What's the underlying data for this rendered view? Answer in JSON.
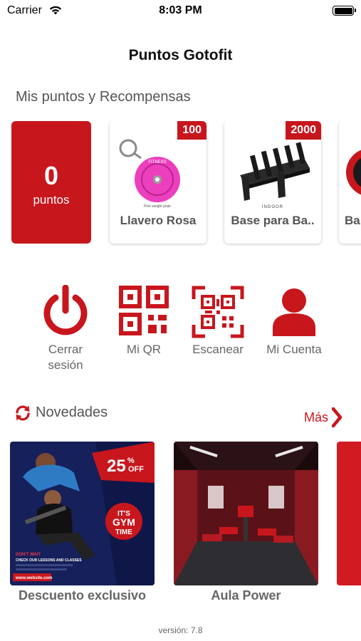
{
  "status_bar": {
    "carrier": "Carrier",
    "time": "8:03 PM",
    "icons": [
      "wifi-icon",
      "battery-icon"
    ]
  },
  "header": {
    "title": "Puntos Gotofit"
  },
  "rewards_section": {
    "heading": "Mis puntos y Recompensas",
    "points": {
      "value": "0",
      "label": "puntos"
    },
    "items": [
      {
        "name": "Llavero Rosa",
        "cost": "100",
        "image": "pink-weight-plate-keychain",
        "image_text": "Pink weight plate"
      },
      {
        "name": "Base para Ba..",
        "cost": "2000",
        "image": "barbell-rack-stand",
        "image_text": "INDOOR"
      },
      {
        "name": "Ba",
        "cost": "",
        "image": "weight-plate"
      }
    ]
  },
  "actions": [
    {
      "label": "Cerrar sesión",
      "icon": "power-icon"
    },
    {
      "label": "Mi QR",
      "icon": "qr-code-icon"
    },
    {
      "label": "Escanear",
      "icon": "qr-scan-icon"
    },
    {
      "label": "Mi Cuenta",
      "icon": "user-icon"
    }
  ],
  "news": {
    "heading": "Novedades",
    "more_label": "Más",
    "items": [
      {
        "title": "Descuento exclusivo",
        "image": "gym-promo-banner",
        "promo": {
          "discount": "25",
          "percent": "%",
          "off": "OFF",
          "line1": "IT'S",
          "line2": "GYM",
          "line3": "TIME",
          "cta": "DON'T WAIT",
          "cta_sub": "CHECK OUR LESSONS AND CLASSES",
          "website": "www.website.com"
        }
      },
      {
        "title": "Aula Power",
        "image": "dark-red-gym-room"
      },
      {
        "title": "",
        "image": "red-banner"
      }
    ]
  },
  "footer": {
    "version": "versión: 7.8"
  },
  "colors": {
    "accent": "#c8161d",
    "text_muted": "#555555"
  }
}
